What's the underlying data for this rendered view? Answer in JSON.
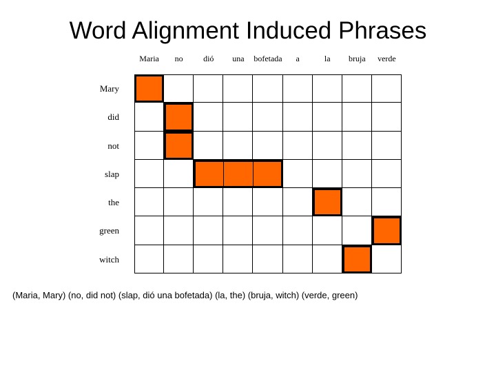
{
  "title": "Word Alignment Induced Phrases",
  "matrix": {
    "columns": [
      "Maria",
      "no",
      "dió",
      "una",
      "bofetada",
      "a",
      "la",
      "bruja",
      "verde"
    ],
    "rows": [
      "Mary",
      "did",
      "not",
      "slap",
      "the",
      "green",
      "witch"
    ],
    "fill_color": "#FF6600",
    "line_color": "#000000",
    "blocks": [
      {
        "name": "maria-mary",
        "row": 0,
        "col_start": 0,
        "col_span": 1
      },
      {
        "name": "no-did",
        "row": 1,
        "col_start": 1,
        "col_span": 1
      },
      {
        "name": "no-not",
        "row": 2,
        "col_start": 1,
        "col_span": 1
      },
      {
        "name": "slap-dio-una-bofetada",
        "row": 3,
        "col_start": 2,
        "col_span": 3
      },
      {
        "name": "la-the",
        "row": 4,
        "col_start": 6,
        "col_span": 1
      },
      {
        "name": "verde-green",
        "row": 5,
        "col_start": 8,
        "col_span": 1
      },
      {
        "name": "bruja-witch",
        "row": 6,
        "col_start": 7,
        "col_span": 1
      }
    ]
  },
  "caption": "(Maria, Mary) (no, did not) (slap, dió una bofetada) (la, the) (bruja, witch) (verde, green)",
  "chart_data": {
    "type": "heatmap",
    "title": "Word Alignment Induced Phrases",
    "xlabel": "",
    "ylabel": "",
    "x_tick_labels": [
      "Maria",
      "no",
      "dió",
      "una",
      "bofetada",
      "a",
      "la",
      "bruja",
      "verde"
    ],
    "y_tick_labels": [
      "Mary",
      "did",
      "not",
      "slap",
      "the",
      "green",
      "witch"
    ],
    "grid": true,
    "legend": "none",
    "values": [
      [
        1,
        0,
        0,
        0,
        0,
        0,
        0,
        0,
        0
      ],
      [
        0,
        1,
        0,
        0,
        0,
        0,
        0,
        0,
        0
      ],
      [
        0,
        1,
        0,
        0,
        0,
        0,
        0,
        0,
        0
      ],
      [
        0,
        0,
        1,
        1,
        1,
        0,
        0,
        0,
        0
      ],
      [
        0,
        0,
        0,
        0,
        0,
        0,
        1,
        0,
        0
      ],
      [
        0,
        0,
        0,
        0,
        0,
        0,
        0,
        0,
        1
      ],
      [
        0,
        0,
        0,
        0,
        0,
        0,
        0,
        1,
        0
      ]
    ],
    "alignment_pairs": [
      {
        "source": "Maria",
        "target": "Mary"
      },
      {
        "source": "no",
        "target": "did not"
      },
      {
        "source": "dió una bofetada",
        "target": "slap"
      },
      {
        "source": "la",
        "target": "the"
      },
      {
        "source": "bruja",
        "target": "witch"
      },
      {
        "source": "verde",
        "target": "green"
      }
    ],
    "annotations": [
      "(Maria, Mary) (no, did not) (slap, dió una bofetada) (la, the) (bruja, witch) (verde, green)"
    ]
  }
}
